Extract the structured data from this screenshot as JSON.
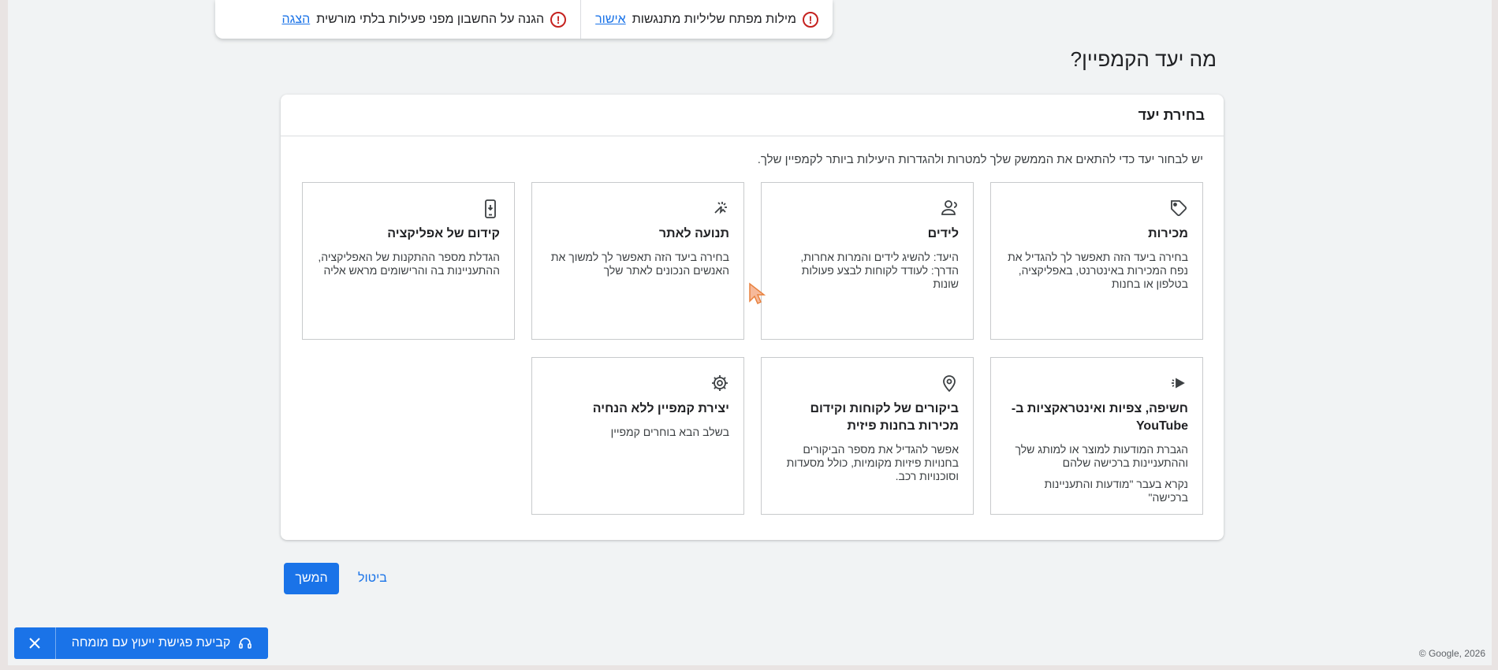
{
  "notifications": [
    {
      "message": "מילות מפתח שליליות מתנגשות",
      "action": "אישור"
    },
    {
      "message": "הגנה על החשבון מפני פעילות בלתי מורשית",
      "action": "הצגה"
    }
  ],
  "page": {
    "title": "מה יעד הקמפיין?"
  },
  "card": {
    "header": "בחירת יעד",
    "description": "יש לבחור יעד כדי להתאים את הממשק שלך למטרות ולהגדרות היעילות ביותר לקמפיין שלך."
  },
  "goals": [
    {
      "icon": "tag-icon",
      "title": "מכירות",
      "description": "בחירה ביעד הזה תאפשר לך להגדיל את נפח המכירות באינטרנט, באפליקציה, בטלפון או בחנות",
      "note": ""
    },
    {
      "icon": "person-group-icon",
      "title": "לידים",
      "description": "היעד: להשיג לידים והמרות אחרות, הדרך: לעודד לקוחות לבצע פעולות שונות",
      "note": ""
    },
    {
      "icon": "cursor-click-icon",
      "title": "תנועה לאתר",
      "description": "בחירה ביעד הזה תאפשר לך למשוך את האנשים הנכונים לאתר שלך",
      "note": ""
    },
    {
      "icon": "smartphone-icon",
      "title": "קידום של אפליקציה",
      "description": "הגדלת מספר ההתקנות של האפליקציה, ההתעניינות בה והרישומים מראש אליה",
      "note": ""
    },
    {
      "icon": "megaphone-sparkle-icon",
      "title": "חשיפה, צפיות ואינטראקציות ב-YouTube",
      "description": "הגברת המודעות למוצר או למותג שלך וההתעניינות ברכישה שלהם",
      "note": "נקרא בעבר \"מודעות והתעניינות ברכישה\""
    },
    {
      "icon": "location-pin-icon",
      "title": "ביקורים של לקוחות וקידום מכירות בחנות פיזית",
      "description": "אפשר להגדיל את מספר הביקורים בחנויות פיזיות מקומיות, כולל מסעדות וסוכנויות רכב.",
      "note": ""
    },
    {
      "icon": "gear-icon",
      "title": "יצירת קמפיין ללא הנחיה",
      "description": "בשלב הבא בוחרים קמפיין",
      "note": ""
    }
  ],
  "actions": {
    "continue": "המשך",
    "cancel": "ביטול"
  },
  "consult_banner": {
    "label": "קביעת פגישת ייעוץ עם מומחה"
  },
  "footer": {
    "copyright": "© Google, 2026"
  },
  "colors": {
    "accent": "#1a73e8",
    "warning": "#c5221f",
    "background": "#f1f3f4"
  }
}
